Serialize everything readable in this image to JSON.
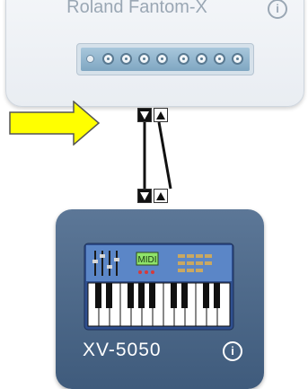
{
  "top_device": {
    "name": "Roland Fantom-X",
    "info_label": "i"
  },
  "bottom_device": {
    "name": "XV-5050",
    "info_label": "i",
    "icon_label": "MIDI"
  },
  "colors": {
    "arrow_fill": "#ffff00",
    "arrow_stroke": "#555555",
    "bottom_card": "#4a6586",
    "top_card": "#eef1f5"
  },
  "icons": [
    "midi-interface-icon",
    "yellow-right-arrow-icon",
    "down-arrow-icon",
    "up-arrow-icon",
    "keyboard-synth-icon",
    "info-icon"
  ]
}
